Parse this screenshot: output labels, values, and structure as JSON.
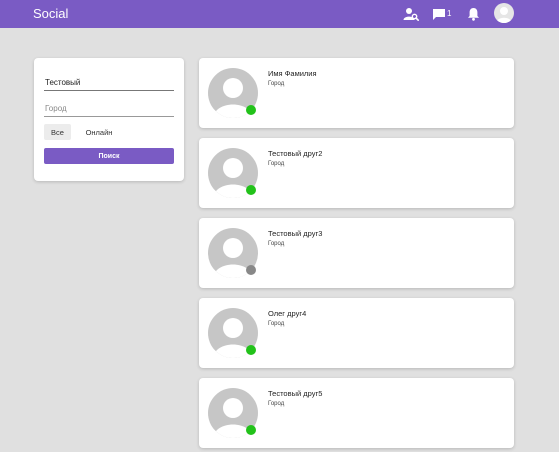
{
  "header": {
    "brand": "Social",
    "message_count": "1"
  },
  "filter": {
    "name_value": "Тестовый",
    "city_placeholder": "Город",
    "toggle_all": "Все",
    "toggle_online": "Онлайн",
    "search_label": "Поиск"
  },
  "colors": {
    "accent": "#7a5bc4",
    "online": "#22c21a",
    "offline": "#888888",
    "background": "#e0e0e0"
  },
  "users": [
    {
      "name": "Имя Фамилия",
      "city": "Город",
      "online": true
    },
    {
      "name": "Тестовый друг2",
      "city": "Город",
      "online": true
    },
    {
      "name": "Тестовый друг3",
      "city": "Город",
      "online": false
    },
    {
      "name": "Олег друг4",
      "city": "Город",
      "online": true
    },
    {
      "name": "Тестовый друг5",
      "city": "Город",
      "online": true
    }
  ]
}
